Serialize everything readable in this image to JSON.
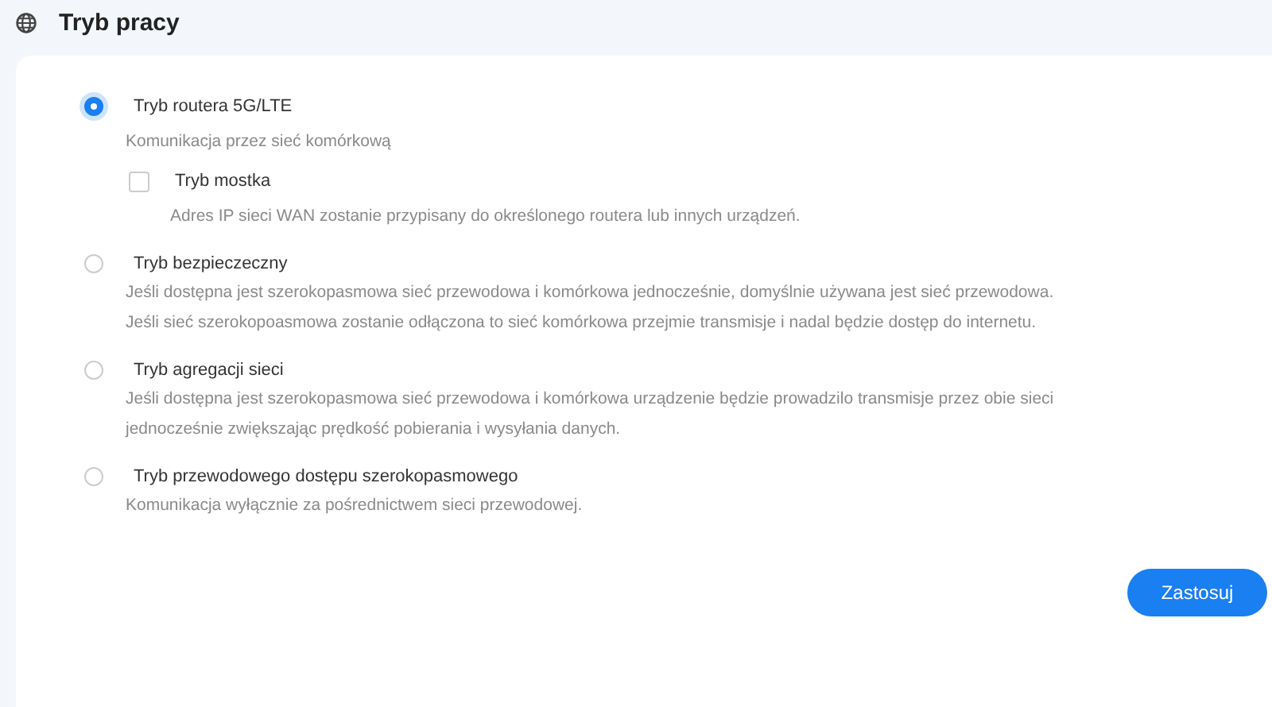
{
  "header": {
    "title": "Tryb pracy"
  },
  "modes": [
    {
      "label": "Tryb routera 5G/LTE",
      "selected": true,
      "description": [
        "Komunikacja przez sieć komórkową"
      ],
      "suboptions": [
        {
          "label": "Tryb mostka",
          "checked": false,
          "description": "Adres IP sieci WAN zostanie przypisany do określonego routera lub innych urządzeń."
        }
      ]
    },
    {
      "label": "Tryb bezpieczeczny",
      "selected": false,
      "description": [
        "Jeśli dostępna jest szerokopasmowa sieć przewodowa i komórkowa jednocześnie, domyślnie używana jest sieć przewodowa.",
        "Jeśli sieć szerokopoasmowa zostanie odłączona to sieć komórkowa przejmie transmisje i nadal będzie dostęp do internetu."
      ]
    },
    {
      "label": "Tryb agregacji sieci",
      "selected": false,
      "description": [
        "Jeśli dostępna jest szerokopasmowa sieć przewodowa i komórkowa urządzenie będzie prowadzilo transmisje przez obie sieci",
        "jednocześnie zwiększając prędkość pobierania i wysyłania danych."
      ]
    },
    {
      "label": "Tryb przewodowego dostępu szerokopasmowego",
      "selected": false,
      "description": [
        "Komunikacja wyłącznie za pośrednictwem sieci przewodowej."
      ]
    }
  ],
  "apply_button": "Zastosuj"
}
